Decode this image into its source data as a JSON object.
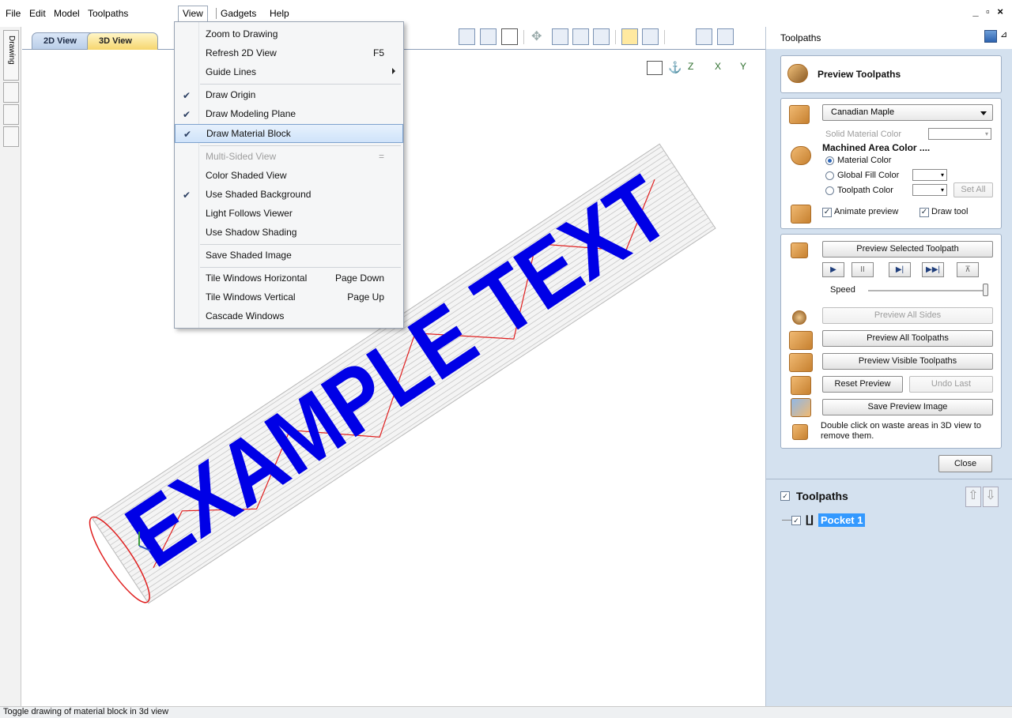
{
  "window": {
    "controls": "_ ▫ ×"
  },
  "menubar": {
    "items": [
      "File",
      "Edit",
      "Model",
      "Toolpaths",
      "View",
      "Gadgets",
      "Help"
    ]
  },
  "left_strip": {
    "tab_label": "Drawing"
  },
  "view_tabs": [
    "2D View",
    "3D View"
  ],
  "view_menu": {
    "items": [
      {
        "label": "Zoom to Drawing",
        "shortcut": "",
        "checked": false
      },
      {
        "label": "Refresh 2D View",
        "shortcut": "F5",
        "checked": false
      },
      {
        "label": "Guide Lines",
        "shortcut": "",
        "checked": false,
        "submenu": true
      },
      {
        "label": "Draw Origin",
        "shortcut": "",
        "checked": true
      },
      {
        "label": "Draw Modeling Plane",
        "shortcut": "",
        "checked": true
      },
      {
        "label": "Draw Material Block",
        "shortcut": "",
        "checked": true,
        "highlighted": true
      },
      {
        "label": "Multi-Sided View",
        "shortcut": "=",
        "checked": false,
        "disabled": true
      },
      {
        "label": "Color Shaded View",
        "shortcut": "",
        "checked": false
      },
      {
        "label": "Use Shaded Background",
        "shortcut": "",
        "checked": true
      },
      {
        "label": "Light Follows Viewer",
        "shortcut": "",
        "checked": false
      },
      {
        "label": "Use Shadow Shading",
        "shortcut": "",
        "checked": false
      },
      {
        "label": "Save Shaded Image",
        "shortcut": "",
        "checked": false
      },
      {
        "label": "Tile Windows Horizontal",
        "shortcut": "Page Down",
        "checked": false
      },
      {
        "label": "Tile Windows Vertical",
        "shortcut": "Page Up",
        "checked": false
      },
      {
        "label": "Cascade Windows",
        "shortcut": "",
        "checked": false
      }
    ]
  },
  "canvas": {
    "model_text": "EXAMPLE TEXT",
    "text_color": "#0000e6",
    "toolpath_color": "#e02020",
    "axis_labels": [
      "Z",
      "X",
      "Y"
    ]
  },
  "panel": {
    "title": "Toolpaths",
    "preview_header": "Preview Toolpaths",
    "material": {
      "selected": "Canadian Maple",
      "solid_color_label": "Solid Material Color",
      "machined_heading": "Machined Area Color ....",
      "radio_material": "Material Color",
      "radio_global": "Global Fill Color",
      "radio_toolpath": "Toolpath Color",
      "set_all": "Set All",
      "animate_label": "Animate preview",
      "draw_tool_label": "Draw tool"
    },
    "buttons": {
      "preview_selected": "Preview Selected Toolpath",
      "speed": "Speed",
      "preview_all_sides": "Preview All Sides",
      "preview_all_toolpaths": "Preview All Toolpaths",
      "preview_visible": "Preview Visible Toolpaths",
      "reset_preview": "Reset Preview",
      "undo_last": "Undo Last",
      "save_preview": "Save Preview Image",
      "hint": "Double click on waste areas in 3D view to remove them.",
      "close": "Close"
    },
    "tree": {
      "heading": "Toolpaths",
      "items": [
        "Pocket 1"
      ]
    }
  },
  "status": {
    "text": "Toggle drawing of material block in 3d view"
  }
}
